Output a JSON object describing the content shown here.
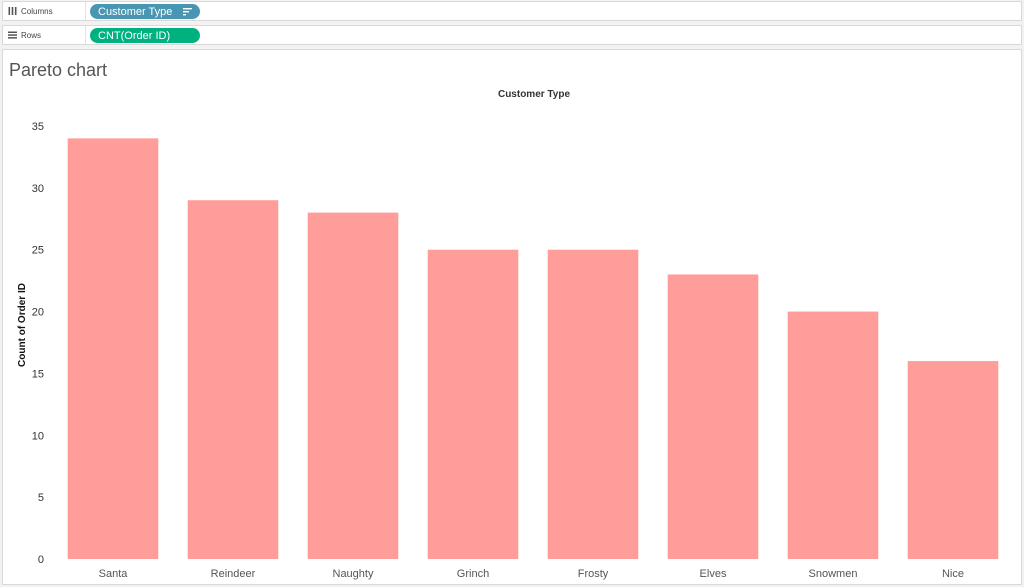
{
  "shelves": {
    "columns": {
      "label": "Columns",
      "icon": "columns-icon",
      "pill": "Customer Type",
      "pill_color": "#4996b2",
      "pill_icon": "sort-descending-icon"
    },
    "rows": {
      "label": "Rows",
      "icon": "rows-icon",
      "pill": "CNT(Order ID)",
      "pill_color": "#00b180"
    }
  },
  "sheet": {
    "title": "Pareto chart"
  },
  "chart_data": {
    "type": "bar",
    "title": "",
    "xlabel": "Customer Type",
    "ylabel": "Count of Order ID",
    "categories": [
      "Santa",
      "Reindeer",
      "Naughty",
      "Grinch",
      "Frosty",
      "Elves",
      "Snowmen",
      "Nice"
    ],
    "values": [
      34,
      29,
      28,
      25,
      25,
      23,
      20,
      16
    ],
    "ylim": [
      0,
      35
    ],
    "yticks": [
      0,
      5,
      10,
      15,
      20,
      25,
      30,
      35
    ],
    "bar_color": "#ff9d9a",
    "grid": false,
    "legend": "none"
  }
}
